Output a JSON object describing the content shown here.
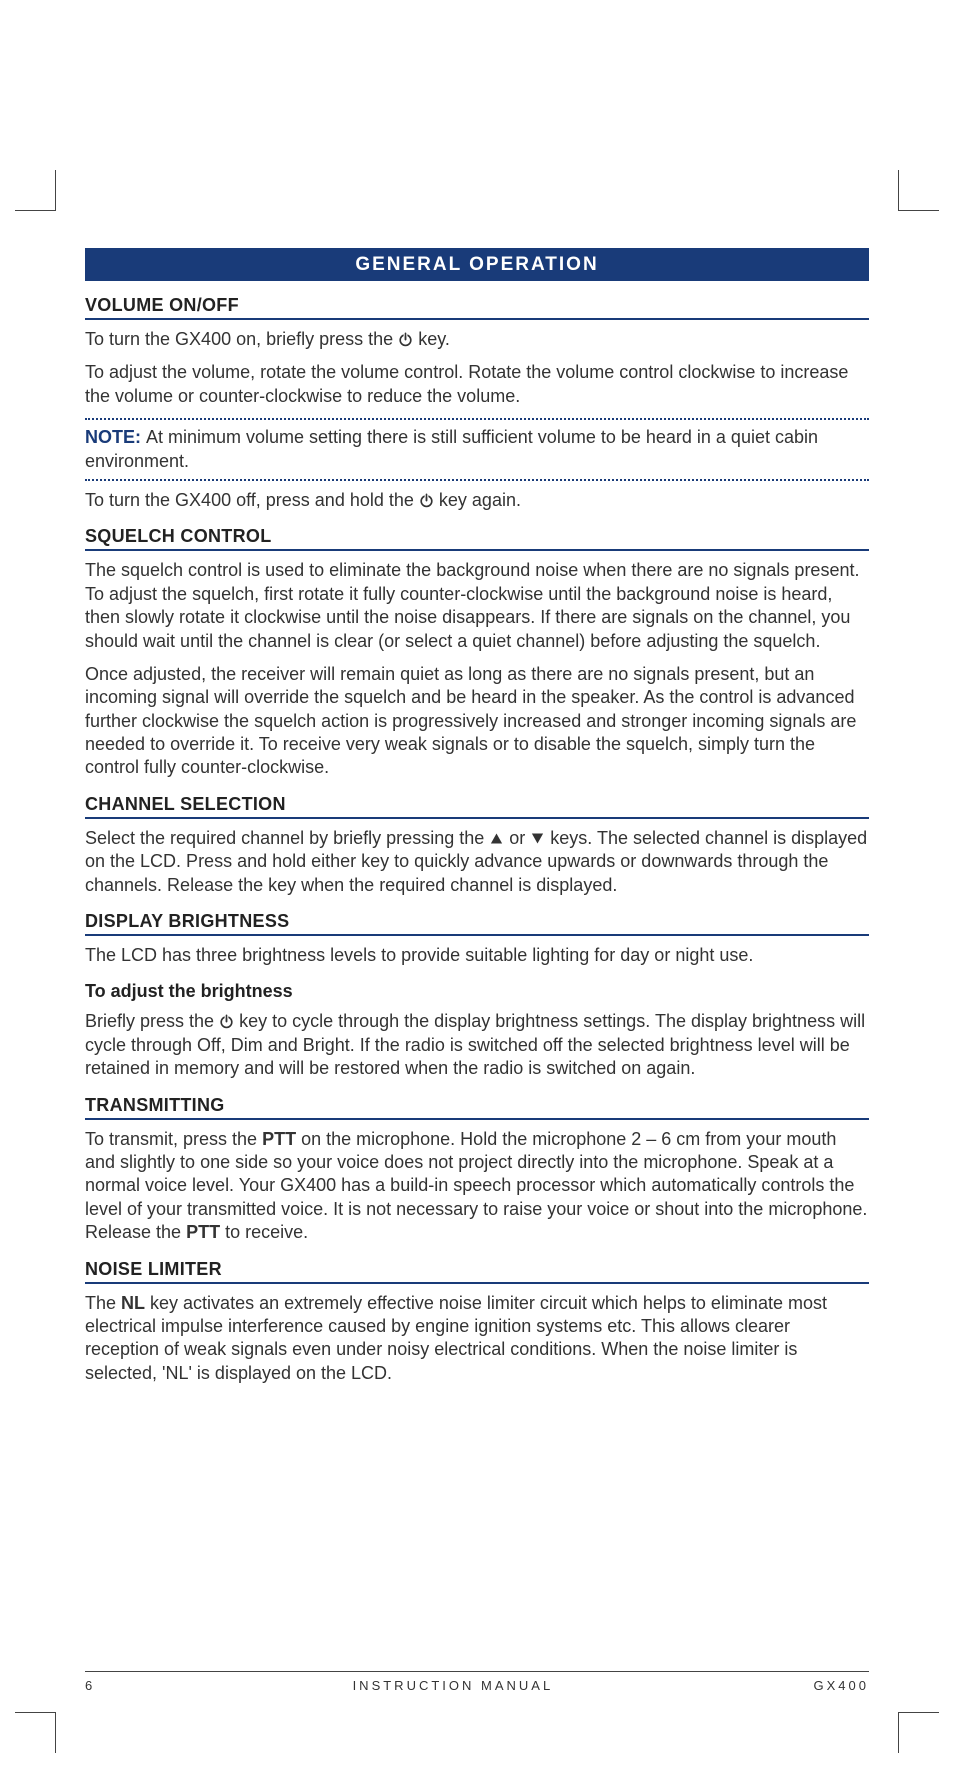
{
  "banner_title": "GENERAL OPERATION",
  "sections": {
    "volume": {
      "heading": "VOLUME ON/OFF",
      "p1a": "To turn the GX400 on, briefly press the ",
      "p1b": " key.",
      "p2": "To adjust the volume, rotate the volume control. Rotate the volume control clockwise to increase the volume or counter-clockwise to reduce the volume.",
      "note_label": "NOTE: ",
      "note_text": "At minimum volume setting there is still sufficient volume to be heard in a quiet cabin environment.",
      "p3a": "To turn the GX400 off, press and hold the ",
      "p3b": " key again."
    },
    "squelch": {
      "heading": "SQUELCH CONTROL",
      "p1": "The squelch control is used to eliminate the background noise when there are no signals present. To adjust the squelch, first rotate it fully counter-clockwise until the background noise is heard, then slowly rotate it clockwise until the noise disappears. If there are signals on the channel, you should wait until the channel is clear (or select a quiet channel) before adjusting the squelch.",
      "p2": "Once adjusted, the receiver will remain quiet as long as there are no signals present, but an incoming signal will override the squelch and be heard in the speaker. As the control is advanced further clockwise the squelch action is progressively increased and stronger incoming signals are needed to override it. To receive very weak signals or to disable the squelch, simply turn the control fully counter-clockwise."
    },
    "channel": {
      "heading": "CHANNEL SELECTION",
      "p1a": "Select the required channel by briefly pressing the ",
      "p1b": " or ",
      "p1c": " keys. The selected channel is displayed on the LCD. Press and hold either key to quickly advance upwards or downwards through the channels. Release the key when the required channel is displayed."
    },
    "brightness": {
      "heading": "DISPLAY BRIGHTNESS",
      "p1": "The LCD has three brightness levels to provide suitable lighting for day or night use.",
      "subhead": "To adjust the brightness",
      "p2a": "Briefly press the ",
      "p2b": " key to cycle through the display brightness settings. The display brightness will cycle through Off, Dim and Bright. If the radio is switched off the selected brightness level will be retained in memory and will be restored when the radio is switched on again."
    },
    "transmitting": {
      "heading": "TRANSMITTING",
      "p1a": "To transmit, press the ",
      "ptt": "PTT",
      "p1b": " on the microphone. Hold the microphone 2 – 6 cm from your mouth and slightly to one side so your voice does not project directly into the microphone. Speak at a normal voice level. Your GX400 has a build-in speech processor which automatically controls the level of your transmitted voice. It is not necessary to raise your voice or shout into the microphone. Release the ",
      "p1c": " to receive."
    },
    "noise": {
      "heading": "NOISE LIMITER",
      "p1a": "The ",
      "nl": "NL",
      "p1b": " key activates an extremely effective noise limiter circuit which helps to eliminate most electrical impulse interference caused by engine ignition systems etc. This allows clearer reception of weak signals even under noisy electrical conditions. When the noise limiter is selected, 'NL' is displayed on the LCD."
    }
  },
  "footer": {
    "page_number": "6",
    "center": "INSTRUCTION MANUAL",
    "right": "GX400"
  }
}
